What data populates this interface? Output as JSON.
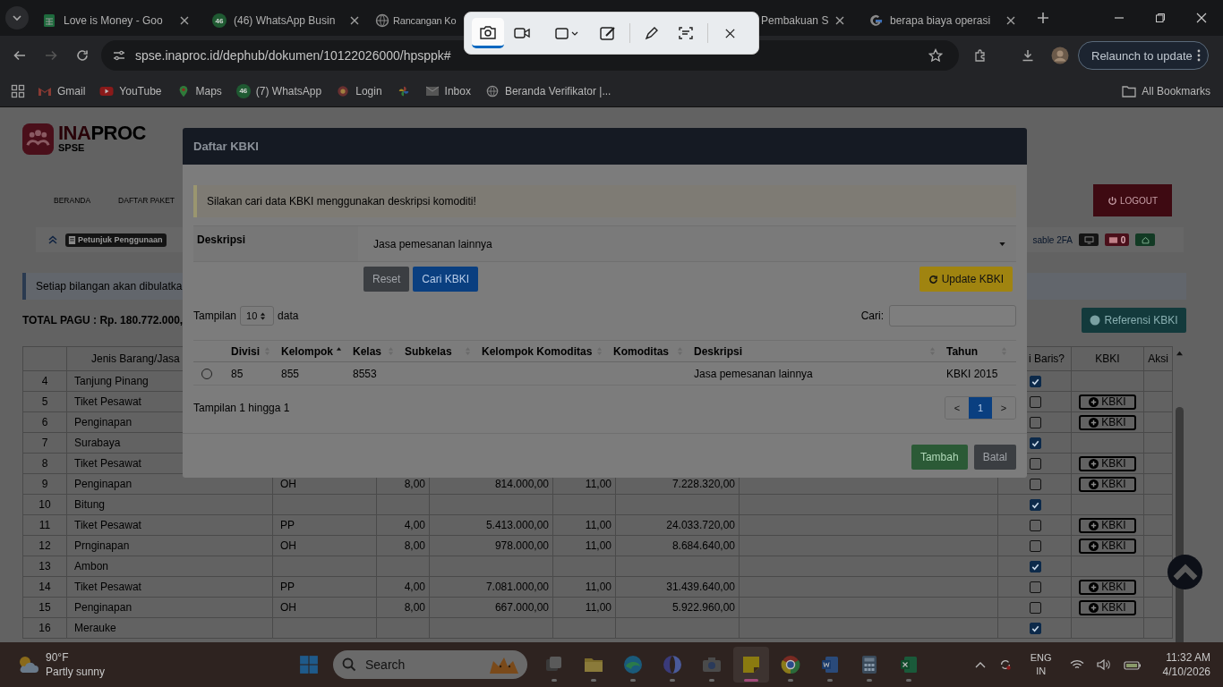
{
  "browser": {
    "tabs": [
      {
        "title": "Love is Money - Goo"
      },
      {
        "title": "(46) WhatsApp Busin",
        "badge": "46"
      },
      {
        "title": "Rancangan Ko"
      },
      {
        "title": "Pembakuan S"
      },
      {
        "title": "berapa biaya operasi"
      }
    ],
    "url": "spse.inaproc.id/dephub/dokumen/10122026000/hpsppk#",
    "relaunch": "Relaunch to update",
    "bookmarks": [
      {
        "label": "Gmail"
      },
      {
        "label": "YouTube"
      },
      {
        "label": "Maps"
      },
      {
        "label": "(7) WhatsApp",
        "badge": "46"
      },
      {
        "label": "Login"
      },
      {
        "label": "Inbox"
      },
      {
        "label": "Beranda Verifikator |..."
      }
    ],
    "all_bookmarks": "All Bookmarks"
  },
  "snip_toolbar": {
    "modes": [
      {
        "selected": true
      },
      {
        "selected": false
      }
    ]
  },
  "page": {
    "logo": {
      "brand_a": "INA",
      "brand_b": "PROC",
      "sub": "SPSE"
    },
    "nav": [
      "BERANDA",
      "DAFTAR PAKET"
    ],
    "logout": "LOGOUT",
    "guide": "Petunjuk Penggunaan",
    "twofa": "sable 2FA",
    "mail_count": "0",
    "notice": "Setiap bilangan akan dibulatka",
    "total": "TOTAL PAGU : Rp. 180.772.000,",
    "reference_button": "Referensi KBKI",
    "table": {
      "name_header": "Jenis Barang/Jasa",
      "check_header": "i Baris?",
      "kbki_header": "KBKI",
      "action_header": "Aksi",
      "rows": [
        {
          "no": "4",
          "name": "Tanjung Pinang",
          "checked": true
        },
        {
          "no": "5",
          "name": "Tiket Pesawat",
          "checked": false,
          "kbki": "KBKI"
        },
        {
          "no": "6",
          "name": "Penginapan",
          "checked": false,
          "kbki": "KBKI"
        },
        {
          "no": "7",
          "name": "Surabaya",
          "checked": true
        },
        {
          "no": "8",
          "name": "Tiket Pesawat",
          "checked": false,
          "kbki": "KBKI"
        },
        {
          "no": "9",
          "name": "Penginapan",
          "unit": "OH",
          "volume": "8,00",
          "price": "814.000,00",
          "koef": "11,00",
          "total": "7.228.320,00",
          "checked": false,
          "kbki": "KBKI"
        },
        {
          "no": "10",
          "name": "Bitung",
          "checked": true
        },
        {
          "no": "11",
          "name": "Tiket Pesawat",
          "unit": "PP",
          "volume": "4,00",
          "price": "5.413.000,00",
          "koef": "11,00",
          "total": "24.033.720,00",
          "checked": false,
          "kbki": "KBKI"
        },
        {
          "no": "12",
          "name": "Prnginapan",
          "unit": "OH",
          "volume": "8,00",
          "price": "978.000,00",
          "koef": "11,00",
          "total": "8.684.640,00",
          "checked": false,
          "kbki": "KBKI"
        },
        {
          "no": "13",
          "name": "Ambon",
          "checked": true
        },
        {
          "no": "14",
          "name": "Tiket Pesawat",
          "unit": "PP",
          "volume": "4,00",
          "price": "7.081.000,00",
          "koef": "11,00",
          "total": "31.439.640,00",
          "checked": false,
          "kbki": "KBKI"
        },
        {
          "no": "15",
          "name": "Penginapan",
          "unit": "OH",
          "volume": "8,00",
          "price": "667.000,00",
          "koef": "11,00",
          "total": "5.922.960,00",
          "checked": false,
          "kbki": "KBKI"
        },
        {
          "no": "16",
          "name": "Merauke",
          "checked": true
        }
      ]
    }
  },
  "modal": {
    "title": "Daftar KBKI",
    "alert": "Silakan cari data KBKI menggunakan deskripsi komoditi!",
    "field_label": "Deskripsi",
    "field_value": "Jasa pemesanan lainnya",
    "reset": "Reset",
    "search_button": "Cari KBKI",
    "update": "Update KBKI",
    "show_prefix": "Tampilan",
    "page_size": "10",
    "show_suffix": "data",
    "search_label": "Cari:",
    "columns": [
      {
        "label": "Divisi",
        "sorted": false
      },
      {
        "label": "Kelompok",
        "sorted": true
      },
      {
        "label": "Kelas",
        "sorted": false
      },
      {
        "label": "Subkelas",
        "sorted": false
      },
      {
        "label": "Kelompok Komoditas",
        "sorted": false
      },
      {
        "label": "Komoditas",
        "sorted": false
      },
      {
        "label": "Deskripsi",
        "sorted": false
      },
      {
        "label": "Tahun",
        "sorted": false
      }
    ],
    "rows": [
      {
        "selected": false,
        "divisi": "85",
        "kelompok": "855",
        "kelas": "8553",
        "deskripsi": "Jasa pemesanan lainnya",
        "tahun": "KBKI 2015"
      }
    ],
    "summary": "Tampilan 1 hingga 1",
    "pager": {
      "prev": "<",
      "pages": [
        {
          "label": "1",
          "selected": true
        }
      ],
      "next": ">"
    },
    "add": "Tambah",
    "cancel": "Batal"
  },
  "taskbar": {
    "weather": {
      "temp": "90°F",
      "desc": "Partly sunny"
    },
    "search": "Search",
    "apps": [
      {
        "active": false
      },
      {
        "active": false
      },
      {
        "active": false
      },
      {
        "active": false
      },
      {
        "active": false
      },
      {
        "active": true
      },
      {
        "active": false
      },
      {
        "active": false
      },
      {
        "active": false
      },
      {
        "active": false
      }
    ],
    "lang": "ENG",
    "region": "IN",
    "time": "11:32 AM",
    "date": "4/10/2026"
  }
}
